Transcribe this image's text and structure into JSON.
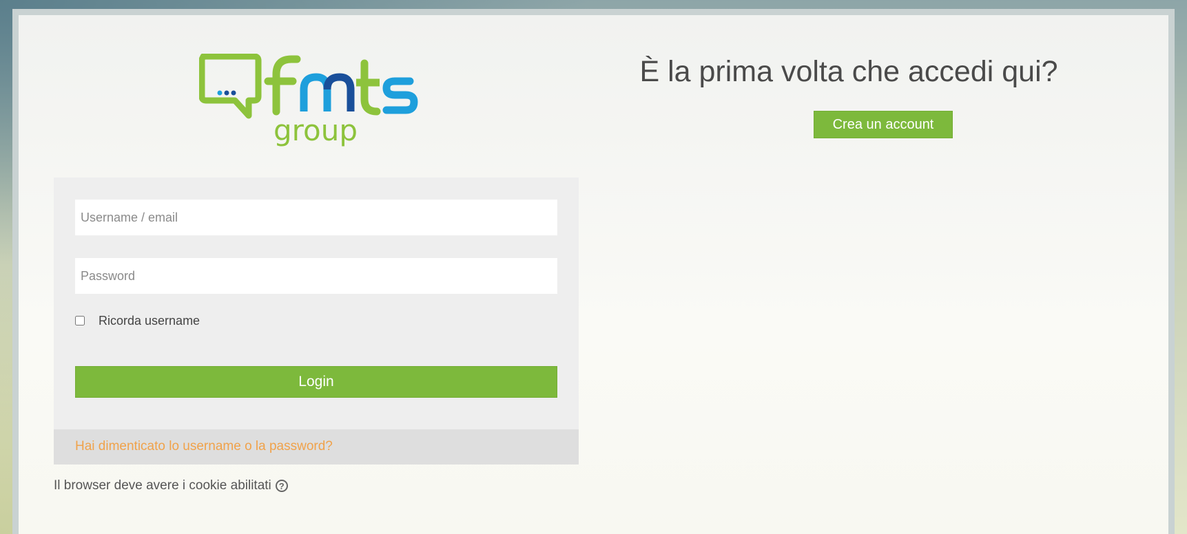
{
  "brand": {
    "logo_word": "fmts",
    "logo_sub": "group",
    "colors": {
      "green": "#8dc33c",
      "blue": "#1e9fdc",
      "dark_blue": "#1a4f9a"
    }
  },
  "login": {
    "username_placeholder": "Username / email",
    "password_placeholder": "Password",
    "remember_label": "Ricorda username",
    "remember_checked": false,
    "login_button": "Login",
    "forgot_link": "Hai dimenticato lo username o la password?",
    "cookie_note": "Il browser deve avere i cookie abilitati",
    "help_icon": "question-circle-icon"
  },
  "signup": {
    "heading": "È la prima volta che accedi qui?",
    "create_button": "Crea un account"
  },
  "theme": {
    "accent": "#7db93c",
    "link": "#f0a24a"
  }
}
